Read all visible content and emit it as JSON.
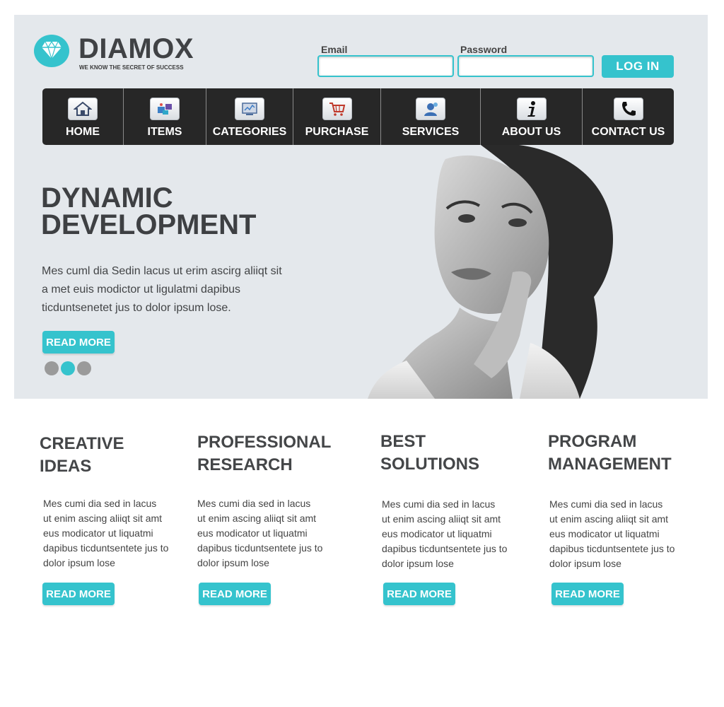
{
  "header": {
    "brand_name": "DIAMOX",
    "tagline": "WE KNOW THE SECRET OF SUCCESS",
    "logo_icon": "diamond-icon"
  },
  "login": {
    "email_label": "Email",
    "password_label": "Password",
    "email_value": "",
    "password_value": "",
    "button_label": "LOG IN"
  },
  "nav": {
    "items": [
      {
        "label": "HOME",
        "icon": "home-icon"
      },
      {
        "label": "ITEMS",
        "icon": "items-icon"
      },
      {
        "label": "CATEGORIES",
        "icon": "categories-icon"
      },
      {
        "label": "PURCHASE",
        "icon": "cart-icon"
      },
      {
        "label": "SERVICES",
        "icon": "services-icon"
      },
      {
        "label": "ABOUT US",
        "icon": "info-icon"
      },
      {
        "label": "CONTACT US",
        "icon": "phone-icon"
      }
    ]
  },
  "hero": {
    "title_line1": "DYNAMIC",
    "title_line2": "DEVELOPMENT",
    "text": "Mes cuml dia Sedin lacus ut erim ascirg aliiqt sit a met euis modictor ut ligulatmi dapibus ticduntsenetet jus to dolor ipsum lose.",
    "button_label": "READ MORE",
    "slider_active_index": 1,
    "slider_count": 3
  },
  "features": [
    {
      "title_line1": "CREATIVE",
      "title_line2": "IDEAS",
      "lines": [
        "Mes cumi dia sed in lacus",
        "ut enim ascing aliiqt sit amt",
        "eus modicator ut liquatmi",
        "dapibus ticduntsentete jus to",
        "dolor ipsum lose"
      ],
      "button_label": "READ MORE"
    },
    {
      "title_line1": "PROFESSIONAL",
      "title_line2": "RESEARCH",
      "lines": [
        "Mes cumi dia sed in lacus",
        "ut enim ascing aliiqt sit amt",
        "eus modicator ut liquatmi",
        "dapibus ticduntsentete jus to",
        "dolor ipsum lose"
      ],
      "button_label": "READ MORE"
    },
    {
      "title_line1": "BEST",
      "title_line2": "SOLUTIONS",
      "lines": [
        "Mes cumi dia sed in lacus",
        "ut enim ascing aliiqt sit amt",
        "eus modicator ut liquatmi",
        "dapibus ticduntsentete jus to",
        "dolor ipsum lose"
      ],
      "button_label": "READ MORE"
    },
    {
      "title_line1": "PROGRAM",
      "title_line2": "MANAGEMENT",
      "lines": [
        "Mes cumi dia sed in lacus",
        "ut enim ascing aliiqt sit amt",
        "eus modicator ut liquatmi",
        "dapibus ticduntsentete jus to",
        "dolor ipsum lose"
      ],
      "button_label": "READ MORE"
    }
  ],
  "colors": {
    "accent": "#35c3cd",
    "nav_background": "#272727",
    "hero_background": "#e4e8ec",
    "heading_text": "#444648"
  }
}
